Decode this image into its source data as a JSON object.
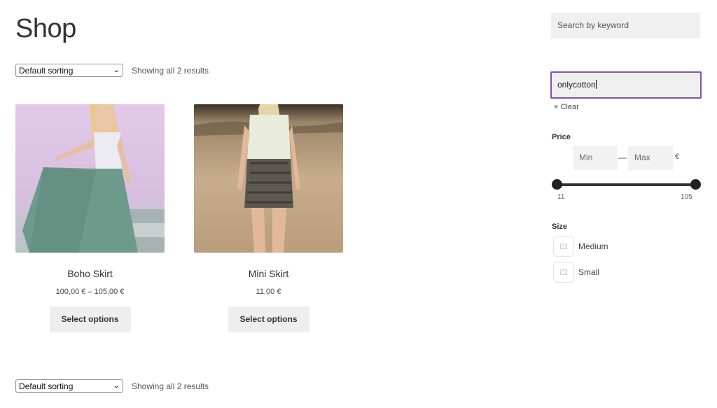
{
  "page": {
    "title": "Shop"
  },
  "sorting": {
    "selected": "Default sorting",
    "results_text": "Showing all 2 results"
  },
  "products": [
    {
      "title": "Boho Skirt",
      "price": "100,00 € – 105,00 €",
      "button_label": "Select options",
      "image_icon": "product-image-boho-skirt"
    },
    {
      "title": "Mini Skirt",
      "price": "11,00 €",
      "button_label": "Select options",
      "image_icon": "product-image-mini-skirt"
    }
  ],
  "sidebar": {
    "search": {
      "placeholder": "Search by keyword"
    },
    "attribute_search": {
      "value": "onlycotton",
      "clear_label": "× Clear"
    },
    "price": {
      "title": "Price",
      "min_placeholder": "Min",
      "max_placeholder": "Max",
      "dash": "—",
      "currency": "€",
      "range_min": "11",
      "range_max": "105"
    },
    "size": {
      "title": "Size",
      "options": [
        {
          "label": "Medium"
        },
        {
          "label": "Small"
        }
      ]
    }
  },
  "colors": {
    "accent": "#7f54b3",
    "button_bg": "#eeeeee",
    "input_bg": "#f0f0f0"
  }
}
